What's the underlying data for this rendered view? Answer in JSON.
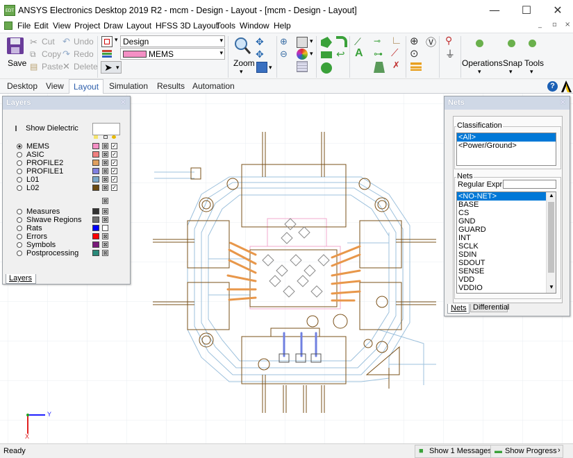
{
  "window": {
    "title": "ANSYS Electronics Desktop 2019 R2 - mcm - Design - Layout - [mcm - Design - Layout]",
    "app_icon": "EDT",
    "minimize": "—",
    "maximize": "☐",
    "close": "✕"
  },
  "menubar": {
    "items": [
      "File",
      "Edit",
      "View",
      "Project",
      "Draw",
      "Layout",
      "HFSS 3D Layout",
      "Tools",
      "Window",
      "Help"
    ],
    "mdi_controls": [
      "_",
      "▫",
      "×"
    ]
  },
  "ribbon": {
    "save": "Save",
    "cut": "Cut",
    "copy": "Copy",
    "paste": "Paste",
    "undo": "Undo",
    "redo": "Redo",
    "delete": "Delete",
    "design_dropdown": "Design",
    "layer_dropdown": "MEMS",
    "layer_color": "#f48fc4",
    "zoom": "Zoom",
    "operations": "Operations",
    "snap": "Snap",
    "tools": "Tools"
  },
  "tabs": [
    "Desktop",
    "View",
    "Layout",
    "Simulation",
    "Results",
    "Automation"
  ],
  "active_tab": "Layout",
  "layers_panel": {
    "title": "Layers",
    "show_dielectric": "Show Dielectric",
    "layers": [
      {
        "name": "MEMS",
        "color": "#f48fc4",
        "selected": true
      },
      {
        "name": "ASIC",
        "color": "#f08080",
        "selected": false
      },
      {
        "name": "PROFILE2",
        "color": "#e0a060",
        "selected": false
      },
      {
        "name": "PROFILE1",
        "color": "#8080e0",
        "selected": false
      },
      {
        "name": "L01",
        "color": "#7aa8c8",
        "selected": false
      },
      {
        "name": "L02",
        "color": "#6b4a10",
        "selected": false
      }
    ],
    "others": [
      {
        "name": "Measures",
        "color": "#333333"
      },
      {
        "name": "SIwave Regions",
        "color": "#707070"
      },
      {
        "name": "Rats",
        "color": "#0000ff"
      },
      {
        "name": "Errors",
        "color": "#ff0000"
      },
      {
        "name": "Symbols",
        "color": "#7a1a7a"
      },
      {
        "name": "Postprocessing",
        "color": "#2a8a7a"
      }
    ],
    "tab": "Layers"
  },
  "nets_panel": {
    "title": "Nets",
    "classification_label": "Classification",
    "classifications": [
      "<All>",
      "<Power/Ground>"
    ],
    "nets_label": "Nets",
    "regex_label": "Regular Expr:",
    "nets": [
      "<NO-NET>",
      "BASE",
      "CS",
      "GND",
      "GUARD",
      "INT",
      "SCLK",
      "SDIN",
      "SDOUT",
      "SENSE",
      "VDD",
      "VDDIO"
    ],
    "tabs": [
      "Nets",
      "Differential"
    ]
  },
  "status": {
    "text": "Ready",
    "messages_button": "Show 1 Messages",
    "progress_button": "Show Progress"
  },
  "axis": {
    "y": "Y",
    "x": "X"
  }
}
